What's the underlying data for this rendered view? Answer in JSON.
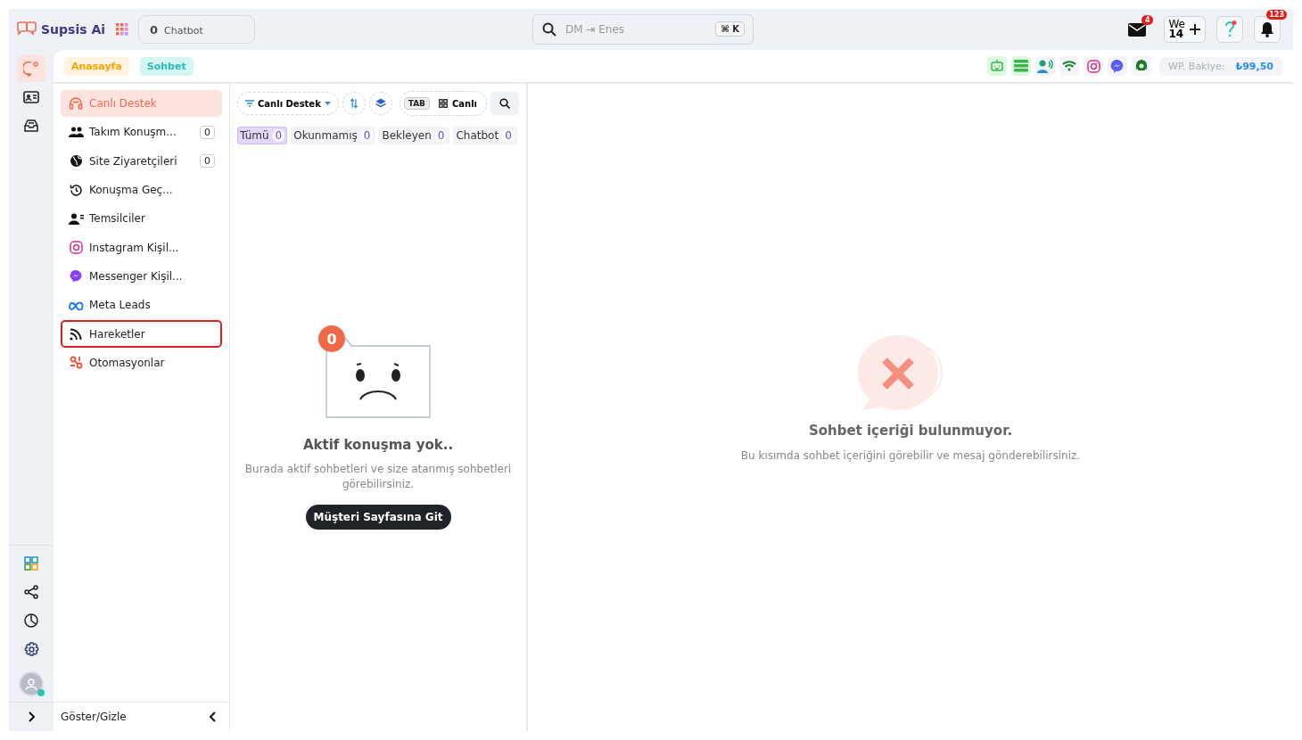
{
  "brand": {
    "name": "Supsis Ai"
  },
  "chatbot_pill": {
    "count": "0",
    "label": "Chatbot"
  },
  "search": {
    "placeholder": "DM ⇥ Enes",
    "shortcut": "⌘ K"
  },
  "header": {
    "mail_badge": "4",
    "workspace": {
      "line1": "We",
      "line2": "14"
    },
    "notification_badge": "123"
  },
  "rail": {
    "top": [
      {
        "kind": "chat",
        "selected": true
      },
      {
        "kind": "contact",
        "selected": false
      },
      {
        "kind": "inbox",
        "selected": false
      }
    ],
    "bottom": [
      {
        "kind": "apps"
      },
      {
        "kind": "share"
      },
      {
        "kind": "pie"
      },
      {
        "kind": "settings"
      }
    ]
  },
  "breadcrumbs": [
    {
      "label": "Anasayfa",
      "kind": "home"
    },
    {
      "label": "Sohbet",
      "kind": "chat"
    }
  ],
  "channels": [
    {
      "kind": "bot",
      "active": true
    },
    {
      "kind": "list",
      "active": true
    },
    {
      "kind": "agent",
      "active": false
    },
    {
      "kind": "wifi",
      "active": false
    },
    {
      "kind": "instagram",
      "active": false
    },
    {
      "kind": "messenger",
      "active": false
    },
    {
      "kind": "whatsapp",
      "active": false
    }
  ],
  "balance": {
    "label": "WP. Bakiye:",
    "value": "₺99,50"
  },
  "sidebar": {
    "items": [
      {
        "label": "Canlı Destek",
        "kind": "headset",
        "selected": true,
        "highlighted": false
      },
      {
        "label": "Takım Konuşm...",
        "kind": "team",
        "count": "0",
        "selected": false,
        "highlighted": false
      },
      {
        "label": "Site Ziyaretçileri",
        "kind": "globe",
        "count": "0",
        "selected": false,
        "highlighted": false
      },
      {
        "label": "Konuşma Geç...",
        "kind": "history",
        "selected": false,
        "highlighted": false
      },
      {
        "label": "Temsilciler",
        "kind": "agents",
        "selected": false,
        "highlighted": false
      },
      {
        "label": "Instagram Kişil...",
        "kind": "instagram",
        "selected": false,
        "highlighted": false
      },
      {
        "label": "Messenger Kişil...",
        "kind": "messenger",
        "selected": false,
        "highlighted": false
      },
      {
        "label": "Meta Leads",
        "kind": "meta",
        "selected": false,
        "highlighted": false
      },
      {
        "label": "Hareketler",
        "kind": "rss",
        "selected": false,
        "highlighted": true
      },
      {
        "label": "Otomasyonlar",
        "kind": "automation",
        "selected": false,
        "highlighted": false
      }
    ],
    "footer": "Göster/Gizle"
  },
  "list": {
    "filter": "Canlı Destek",
    "tab_key": "TAB",
    "view": "Canlı",
    "tabs": [
      {
        "label": "Tümü",
        "count": "0",
        "selected": true
      },
      {
        "label": "Okunmamış",
        "count": "0",
        "selected": false
      },
      {
        "label": "Bekleyen",
        "count": "0",
        "selected": false
      },
      {
        "label": "Chatbot",
        "count": "0",
        "selected": false
      }
    ],
    "empty": {
      "badge": "0",
      "title": "Aktif konuşma yok..",
      "text": "Burada aktif sohbetleri ve size atanmış sohbetleri görebilirsiniz.",
      "button": "Müşteri Sayfasına Git"
    }
  },
  "content": {
    "title": "Sohbet içeriği bulunmuyor.",
    "text": "Bu kısımda sohbet içeriğini görebilir ve mesaj gönderebilirsiniz."
  }
}
